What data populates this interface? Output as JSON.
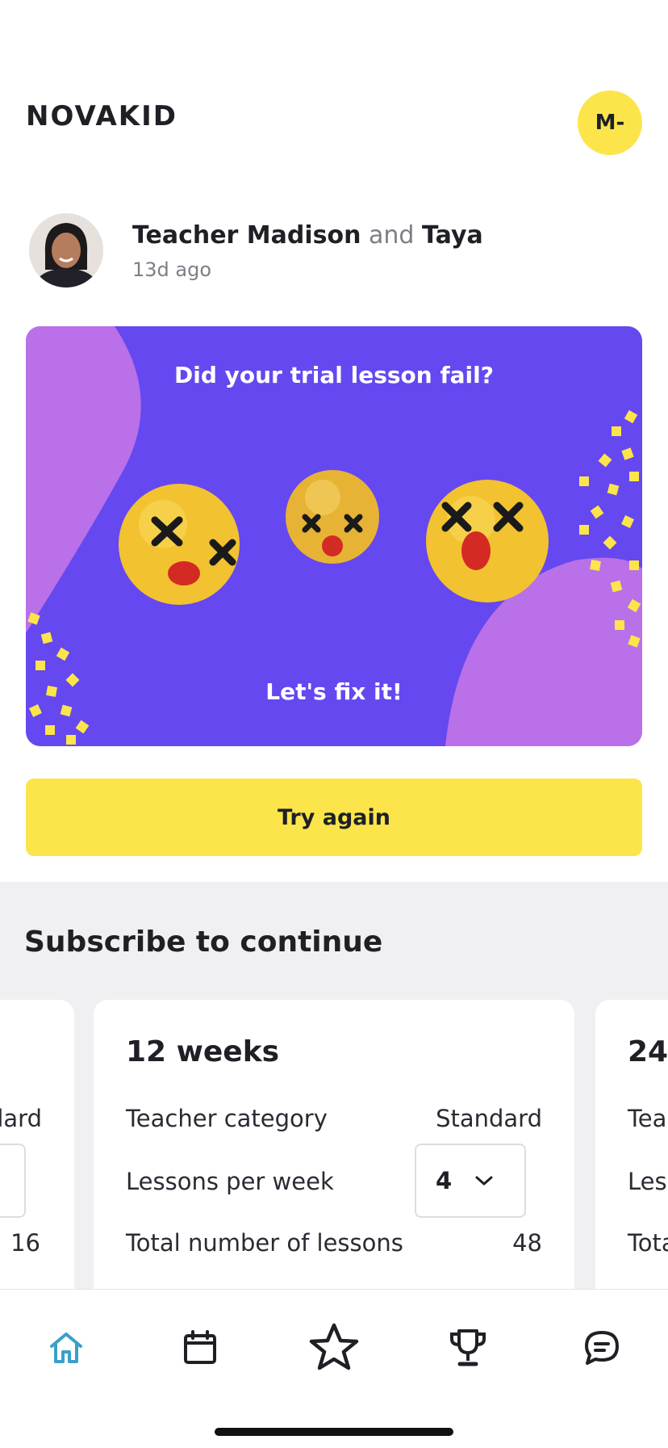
{
  "header": {
    "logo_text": "NOVAKID",
    "user_initials": "M-"
  },
  "post": {
    "teacher_name": "Teacher Madison",
    "connector": "and",
    "student_name": "Taya",
    "time_ago": "13d ago"
  },
  "banner": {
    "title": "Did your trial lesson fail?",
    "subtitle": "Let's fix it!",
    "colors": {
      "background": "#6548f0",
      "blob": "#b970e8",
      "confetti": "#fbe54a"
    }
  },
  "try_again_label": "Try again",
  "subscribe": {
    "title": "Subscribe to continue",
    "plans": [
      {
        "teacher_category_value_partial": "lard",
        "total_lessons_partial": "16"
      },
      {
        "title": "12 weeks",
        "teacher_category_label": "Teacher category",
        "teacher_category_value": "Standard",
        "lessons_per_week_label": "Lessons per week",
        "lessons_per_week_value": "4",
        "total_lessons_label": "Total number of lessons",
        "total_lessons_value": "48"
      },
      {
        "title_partial": "24",
        "teacher_category_label_partial": "Teac",
        "lessons_per_week_label_partial": "Less",
        "total_lessons_label_partial": "Tota"
      }
    ]
  },
  "nav": {
    "items": [
      "home-icon",
      "calendar-icon",
      "star-icon",
      "trophy-icon",
      "chat-icon"
    ],
    "active_color": "#3aa0c8"
  }
}
